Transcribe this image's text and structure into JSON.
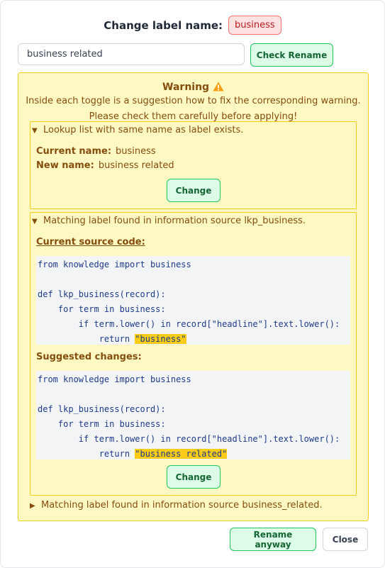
{
  "header": {
    "title": "Change label name:",
    "current_label": "business"
  },
  "rename": {
    "value": "business related",
    "check_button": "Check Rename"
  },
  "warning": {
    "title": "Warning",
    "line1": "Inside each toggle is a suggestion how to fix the corresponding warning.",
    "line2": "Please check them carefully before applying!",
    "toggles": [
      {
        "summary": "Lookup list with same name as label exists.",
        "current_name_label": "Current name:",
        "current_name_value": "business",
        "new_name_label": "New name:",
        "new_name_value": "business related",
        "change_button": "Change"
      },
      {
        "summary": "Matching label found in information source lkp_business.",
        "current_source_title": "Current source code:",
        "current_code": {
          "l1": "from knowledge import business",
          "l3": "def lkp_business(record):",
          "l4": "    for term in business:",
          "l5": "        if term.lower() in record[\"headline\"].text.lower():",
          "l6_prefix": "            return ",
          "l6_highlight": "\"business\""
        },
        "suggested_title": "Suggested changes:",
        "suggested_code": {
          "l1": "from knowledge import business",
          "l3": "def lkp_business(record):",
          "l4": "    for term in business:",
          "l5": "        if term.lower() in record[\"headline\"].text.lower():",
          "l6_prefix": "            return ",
          "l6_highlight": "\"business related\""
        },
        "change_button": "Change"
      },
      {
        "summary": "Matching label found in information source business_related."
      }
    ]
  },
  "footer": {
    "rename_anyway": "Rename anyway",
    "close": "Close"
  },
  "icons": {
    "warning": "warning-triangle-icon",
    "expanded": "triangle-down-icon",
    "collapsed": "triangle-right-icon"
  },
  "colors": {
    "warning_bg": "#fef9c3",
    "warning_border": "#facc15",
    "green_bg": "#dcfce7",
    "green_border": "#22c55e",
    "badge_bg": "#fee2e2",
    "badge_border": "#f87171"
  }
}
